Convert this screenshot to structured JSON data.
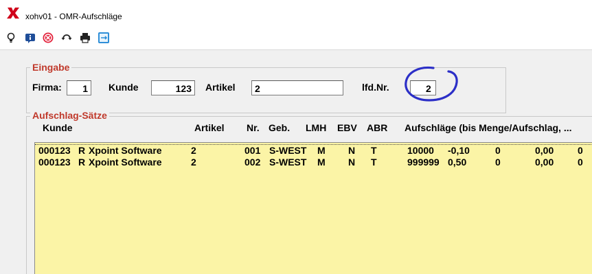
{
  "window": {
    "title": "xohv01 - OMR-Aufschläge"
  },
  "toolbar": {
    "icons": [
      "lightbulb-icon",
      "info-icon",
      "cancel-icon",
      "refresh-icon",
      "print-icon",
      "export-icon"
    ]
  },
  "eingabe": {
    "title": "Eingabe",
    "firma_label": "Firma:",
    "firma_value": "1",
    "kunde_label": "Kunde",
    "kunde_value": "123",
    "artikel_label": "Artikel",
    "artikel_value": "2",
    "lfdnr_label": "lfd.Nr.",
    "lfdnr_value": "2"
  },
  "saetze": {
    "title": "Aufschlag-Sätze",
    "headers": {
      "kunde": "Kunde",
      "artikel": "Artikel",
      "nr": "Nr.",
      "geb": "Geb.",
      "lmh": "LMH",
      "ebv": "EBV",
      "abr": "ABR",
      "aufschlaege": "Aufschläge (bis Menge/Aufschlag, ..."
    },
    "rows": [
      {
        "kunde": "000123",
        "kz": "R",
        "name": "Xpoint Software",
        "artikel": "2",
        "nr": "001",
        "geb": "S-WEST",
        "lmh": "M",
        "ebv": "N",
        "abr": "T",
        "menge": "10000",
        "aufschlag": "-0,10",
        "m2": "0",
        "a2": "0,00",
        "m3": "0"
      },
      {
        "kunde": "000123",
        "kz": "R",
        "name": "Xpoint Software",
        "artikel": "2",
        "nr": "002",
        "geb": "S-WEST",
        "lmh": "M",
        "ebv": "N",
        "abr": "T",
        "menge": "999999",
        "aufschlag": "0,50",
        "m2": "0",
        "a2": "0,00",
        "m3": "0"
      }
    ]
  },
  "colors": {
    "group_title": "#c0392b",
    "list_background": "#fbf4a6",
    "annotation_circle": "#2c2fc7"
  }
}
